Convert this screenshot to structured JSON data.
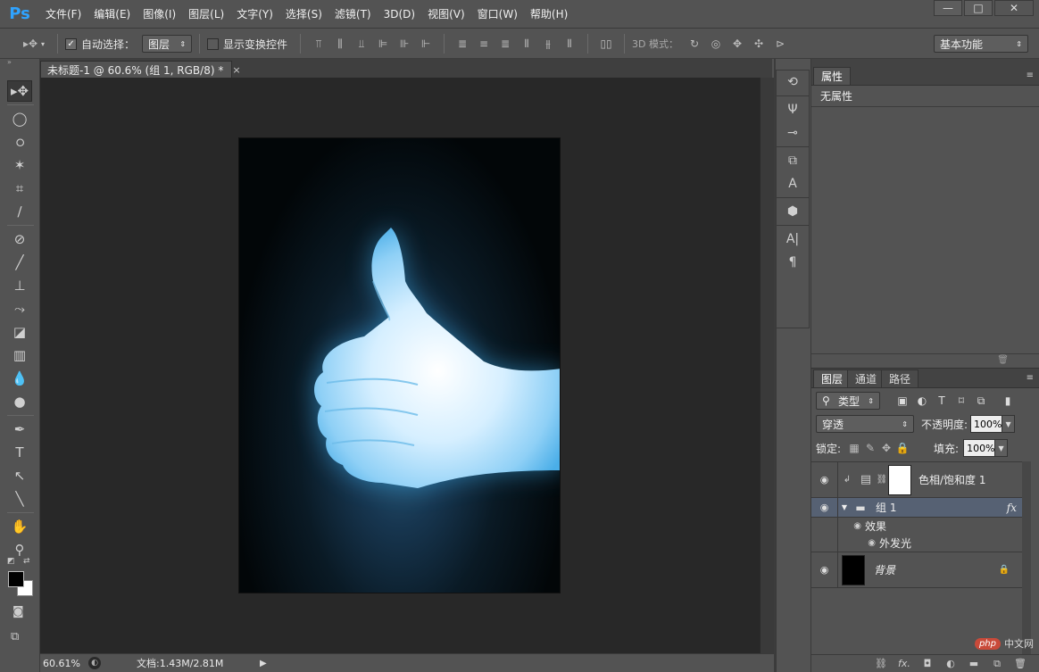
{
  "app": {
    "logo": "Ps",
    "brand_color": "#2fa3ff"
  },
  "menu": [
    "文件(F)",
    "编辑(E)",
    "图像(I)",
    "图层(L)",
    "文字(Y)",
    "选择(S)",
    "滤镜(T)",
    "3D(D)",
    "视图(V)",
    "窗口(W)",
    "帮助(H)"
  ],
  "window_buttons": {
    "minimize": "—",
    "maximize": "□",
    "close": "✕"
  },
  "options": {
    "auto_select_label": "自动选择：",
    "auto_select_checked": "✓",
    "auto_select_target": "图层",
    "show_transform_label": "显示变换控件",
    "mode_3d_label": "3D 模式：",
    "workspace": "基本功能"
  },
  "document": {
    "tab_title": "未标题-1 @ 60.6% (组 1, RGB/8) *",
    "close": "×"
  },
  "status": {
    "zoom": "60.61%",
    "doc_size": "文档:1.43M/2.81M"
  },
  "properties": {
    "tab": "属性",
    "empty_label": "无属性"
  },
  "layers_panel": {
    "tabs": [
      "图层",
      "通道",
      "路径"
    ],
    "filter_kind": "类型",
    "blend_mode": "穿透",
    "opacity_label": "不透明度:",
    "opacity": "100%",
    "lock_label": "锁定:",
    "fill_label": "填充:",
    "fill": "100%",
    "layers": [
      {
        "name": "色相/饱和度 1",
        "type": "adjustment"
      },
      {
        "name": "组 1",
        "type": "group",
        "selected": true,
        "fx": "fx"
      },
      {
        "name": "效果",
        "type": "effect-header"
      },
      {
        "name": "外发光",
        "type": "effect"
      },
      {
        "name": "背景",
        "type": "background",
        "locked": true
      }
    ]
  },
  "watermark": {
    "badge": "php",
    "text": "中文网"
  }
}
